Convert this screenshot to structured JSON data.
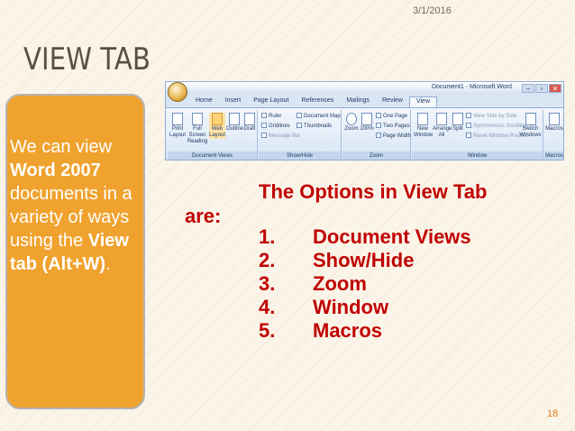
{
  "slide": {
    "date": "3/1/2016",
    "title": "VIEW TAB",
    "page_number": "18",
    "accent_color": "#f0a22e",
    "text_red": "#c00000"
  },
  "side_note": {
    "p1": "We can view ",
    "b1": "Word 2007",
    "p2": " documents in a variety of ways using the ",
    "b2": "View tab (Alt+W)",
    "p3": "."
  },
  "ribbon": {
    "window_title": "Document1 - Microsoft Word",
    "window_buttons": [
      "–",
      "▫",
      "✕"
    ],
    "tabs": [
      "Home",
      "Insert",
      "Page Layout",
      "References",
      "Mailings",
      "Review",
      "View"
    ],
    "active_tab": "View",
    "groups": {
      "document_views": {
        "label": "Document Views",
        "buttons": [
          "Print Layout",
          "Full Screen Reading",
          "Web Layout",
          "Outline",
          "Draft"
        ]
      },
      "show_hide": {
        "label": "Show/Hide",
        "options": [
          "Ruler",
          "Gridlines",
          "Message Bar",
          "Document Map",
          "Thumbnails"
        ]
      },
      "zoom": {
        "label": "Zoom",
        "buttons": [
          "Zoom",
          "100%"
        ],
        "options": [
          "One Page",
          "Two Pages",
          "Page Width"
        ]
      },
      "window": {
        "label": "Window",
        "buttons": [
          "New Window",
          "Arrange All",
          "Split",
          "Switch Windows"
        ],
        "options": [
          "View Side by Side",
          "Synchronous Scrolling",
          "Reset Window Position"
        ]
      },
      "macros": {
        "label": "Macros",
        "buttons": [
          "Macros"
        ]
      }
    }
  },
  "content": {
    "intro_line1": "The Options in View Tab",
    "intro_line2": "are:",
    "items": [
      {
        "num": "1.",
        "label": "Document Views"
      },
      {
        "num": "2.",
        "label": "Show/Hide"
      },
      {
        "num": "3.",
        "label": "Zoom"
      },
      {
        "num": "4.",
        "label": "Window"
      },
      {
        "num": "5.",
        "label": "Macros"
      }
    ]
  }
}
